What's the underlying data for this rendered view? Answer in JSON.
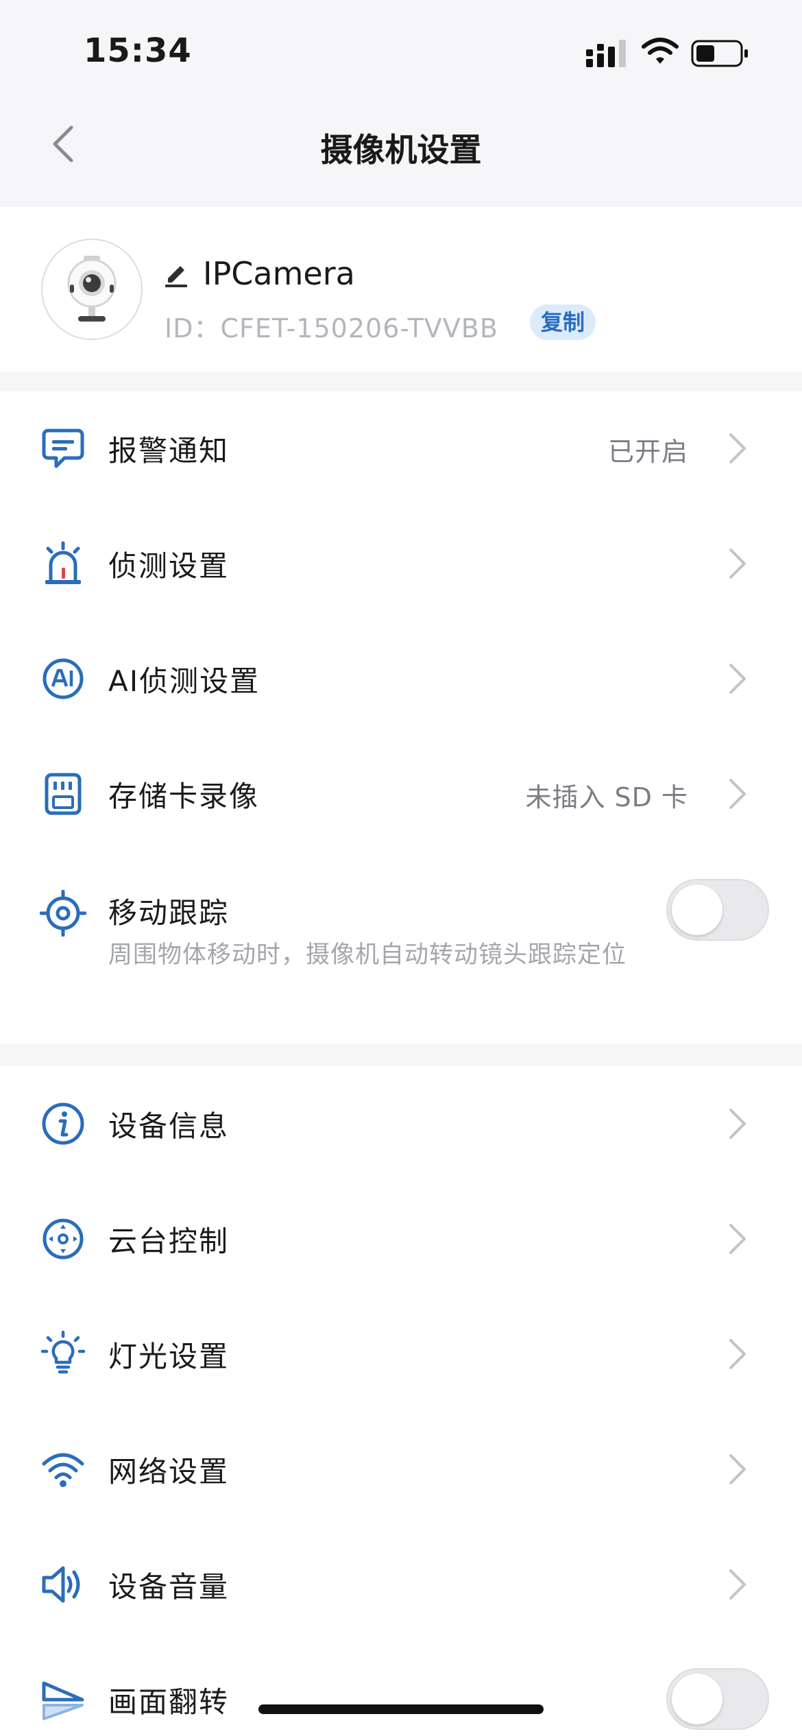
{
  "status_bar": {
    "time": "15:34"
  },
  "nav": {
    "title": "摄像机设置"
  },
  "device": {
    "name": "IPCamera",
    "id_text": "ID：CFET-150206-TVVBB",
    "copy_label": "复制"
  },
  "group1": {
    "alarm": {
      "label": "报警通知",
      "value": "已开启",
      "icon": "chat-bubble-icon"
    },
    "detect": {
      "label": "侦测设置",
      "icon": "alarm-siren-icon"
    },
    "ai_detect": {
      "label": "AI侦测设置",
      "icon": "ai-badge-icon"
    },
    "storage": {
      "label": "存储卡录像",
      "value": "未插入 SD 卡",
      "icon": "sd-card-icon"
    },
    "tracking": {
      "label": "移动跟踪",
      "sub": "周围物体移动时，摄像机自动转动镜头跟踪定位",
      "icon": "crosshair-icon",
      "enabled": false
    }
  },
  "group2": {
    "device_info": {
      "label": "设备信息",
      "icon": "info-icon"
    },
    "ptz": {
      "label": "云台控制",
      "icon": "ptz-direction-icon"
    },
    "light": {
      "label": "灯光设置",
      "icon": "lightbulb-icon"
    },
    "network": {
      "label": "网络设置",
      "icon": "wifi-icon"
    },
    "volume": {
      "label": "设备音量",
      "icon": "speaker-icon"
    },
    "flip": {
      "label": "画面翻转",
      "icon": "flip-icon",
      "enabled": false
    }
  },
  "colors": {
    "accent": "#2a6dbb",
    "accent_red": "#d9463b",
    "background": "#f6f6f8"
  }
}
